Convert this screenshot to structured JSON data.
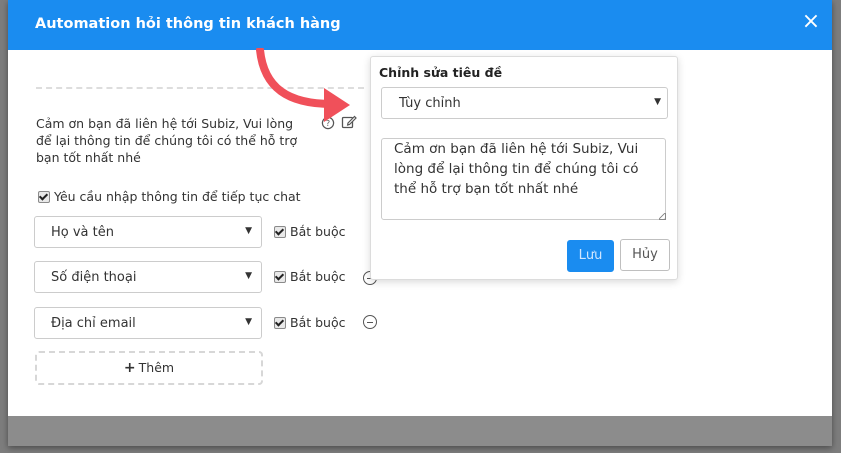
{
  "modal": {
    "title": "Automation hỏi thông tin khách hàng",
    "close_icon": "×"
  },
  "message": {
    "text": "Cảm ơn bạn đã liên hệ tới Subiz, Vui lòng để lại thông tin để chúng tôi có thể hỗ trợ bạn tốt nhất nhé",
    "help_icon": "question-circle-icon",
    "edit_icon": "pencil-square-icon"
  },
  "require_info": {
    "label": "Yêu cầu nhập thông tin để tiếp tục chat",
    "checked": true
  },
  "fields": [
    {
      "select_value": "Họ và tên",
      "required_label": "Bắt buộc",
      "required_checked": true
    },
    {
      "select_value": "Số điện thoại",
      "required_label": "Bắt buộc",
      "required_checked": true
    },
    {
      "select_value": "Địa chỉ email",
      "required_label": "Bắt buộc",
      "required_checked": true
    }
  ],
  "add_button": {
    "plus": "+",
    "label": "Thêm"
  },
  "popover": {
    "title": "Chỉnh sửa tiêu đề",
    "select_value": "Tùy chỉnh",
    "textarea_value": "Cảm ơn bạn đã liên hệ tới Subiz, Vui lòng để lại thông tin để chúng tôi có thể hỗ trợ bạn tốt nhất nhé",
    "save_label": "Lưu",
    "cancel_label": "Hủy"
  },
  "colors": {
    "header_bg": "#1a8cf0",
    "primary": "#1a8cf0",
    "arrow": "#f0505a"
  }
}
